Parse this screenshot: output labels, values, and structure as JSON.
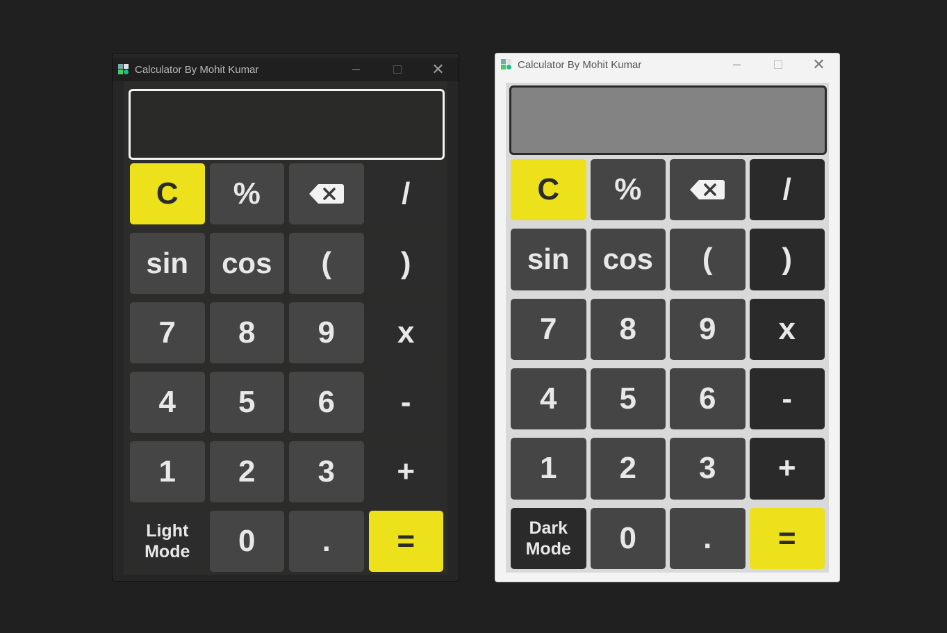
{
  "windows": [
    {
      "theme": "dark",
      "title": "Calculator By Mohit Kumar",
      "display_value": "",
      "keys": [
        "C",
        "%",
        "backspace",
        "/",
        "sin",
        "cos",
        "(",
        ")",
        "7",
        "8",
        "9",
        "x",
        "4",
        "5",
        "6",
        "-",
        "1",
        "2",
        "3",
        "+",
        "Light\nMode",
        "0",
        ".",
        "="
      ]
    },
    {
      "theme": "light",
      "title": "Calculator By Mohit Kumar",
      "display_value": "",
      "keys": [
        "C",
        "%",
        "backspace",
        "/",
        "sin",
        "cos",
        "(",
        ")",
        "7",
        "8",
        "9",
        "x",
        "4",
        "5",
        "6",
        "-",
        "1",
        "2",
        "3",
        "+",
        "Dark\nMode",
        "0",
        ".",
        "="
      ]
    }
  ],
  "colors": {
    "accent": "#ece11a",
    "key": "#454545",
    "operator_key": "#2c2c2c",
    "background": "#202020"
  },
  "icons": {
    "backspace": "backspace-icon",
    "minimize": "minimize-icon",
    "maximize": "maximize-icon",
    "close": "close-icon"
  }
}
